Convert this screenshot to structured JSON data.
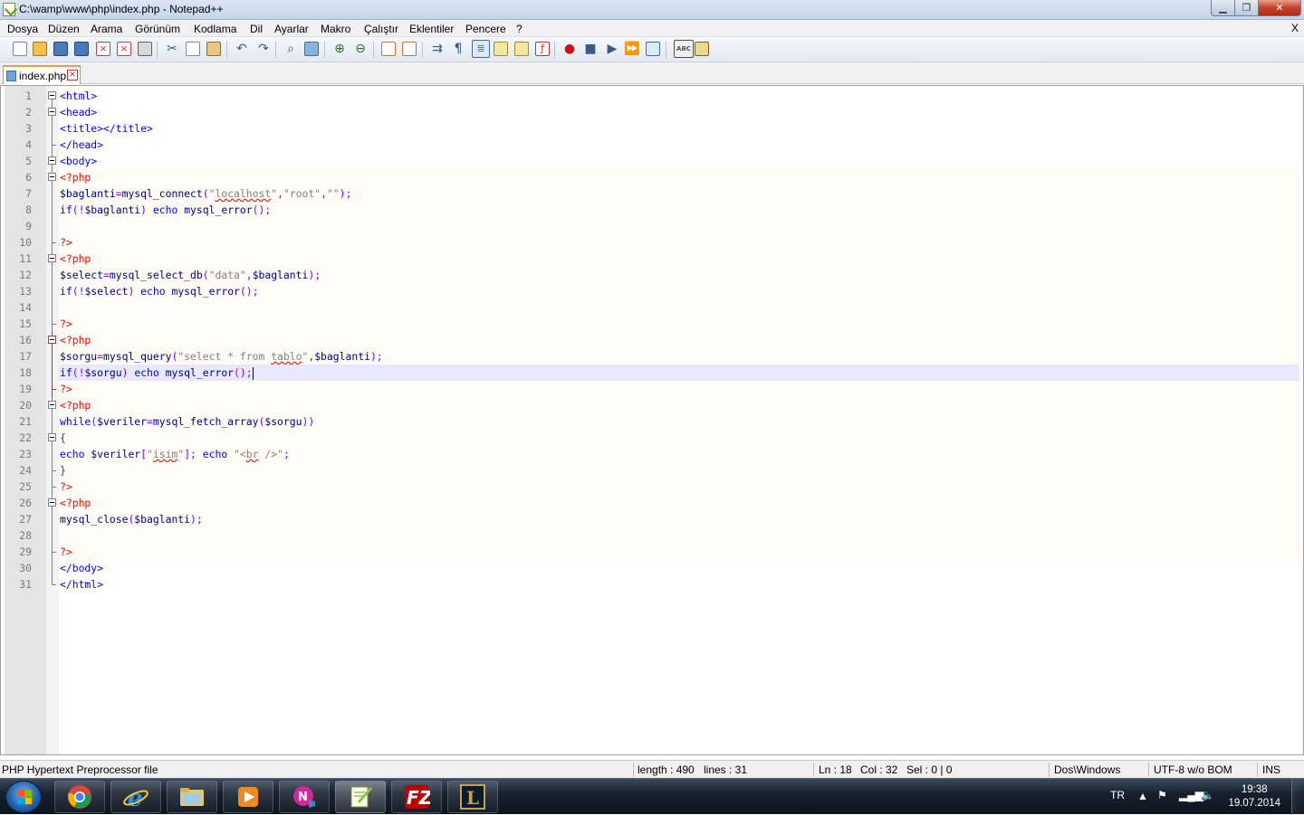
{
  "window": {
    "title": "C:\\wamp\\www\\php\\index.php - Notepad++",
    "min_label": "▁",
    "max_label": "❐",
    "close_label": "✕"
  },
  "menu": {
    "items": [
      "Dosya",
      "Düzen",
      "Arama",
      "Görünüm",
      "Kodlama",
      "Dil",
      "Ayarlar",
      "Makro",
      "Çalıştır",
      "Eklentiler",
      "Pencere",
      "?"
    ],
    "close": "X"
  },
  "toolbar": {
    "icons": [
      "new-file-icon",
      "open-file-icon",
      "save-icon",
      "save-all-icon",
      "close-icon",
      "close-all-icon",
      "print-icon",
      "cut-icon",
      "copy-icon",
      "paste-icon",
      "undo-icon",
      "redo-icon",
      "find-icon",
      "replace-icon",
      "zoom-in-icon",
      "zoom-out-icon",
      "sync-v-icon",
      "sync-h-icon",
      "word-wrap-icon",
      "show-all-chars-icon",
      "indent-guide-icon",
      "user-lang-icon",
      "doc-map-icon",
      "function-list-icon",
      "record-macro-icon",
      "stop-record-icon",
      "play-macro-icon",
      "run-macro-multiple-icon",
      "save-macro-icon",
      "spell-check-icon",
      "plugin-icon"
    ]
  },
  "tab": {
    "label": "index.php",
    "close": "✕"
  },
  "editor": {
    "current_line": 18,
    "lines": [
      {
        "n": "1",
        "fold": "box",
        "tokens": [
          [
            "<html>",
            "tag"
          ]
        ]
      },
      {
        "n": "2",
        "fold": "box",
        "tokens": [
          [
            "<head>",
            "tag"
          ]
        ]
      },
      {
        "n": "3",
        "fold": "line",
        "tokens": [
          [
            "<title></title>",
            "tag"
          ]
        ]
      },
      {
        "n": "4",
        "fold": "end",
        "tokens": [
          [
            "</head>",
            "tag"
          ]
        ]
      },
      {
        "n": "5",
        "fold": "box",
        "tokens": [
          [
            "<body>",
            "tag"
          ]
        ]
      },
      {
        "n": "6",
        "fold": "box",
        "php": true,
        "tokens": [
          [
            "<?php",
            "php"
          ]
        ]
      },
      {
        "n": "7",
        "fold": "line",
        "php": true,
        "tokens": [
          [
            "$baglanti",
            "var"
          ],
          [
            "=",
            "op"
          ],
          [
            "mysql_connect",
            "fn"
          ],
          [
            "(",
            "op"
          ],
          [
            "\"",
            "str"
          ],
          [
            "localhost",
            "strsq"
          ],
          [
            "\"",
            "str"
          ],
          [
            ",",
            "op"
          ],
          [
            "\"root\"",
            "str"
          ],
          [
            ",",
            "op"
          ],
          [
            "\"\"",
            "str"
          ],
          [
            ");",
            "op"
          ]
        ]
      },
      {
        "n": "8",
        "fold": "line",
        "php": true,
        "tokens": [
          [
            "if",
            "kw"
          ],
          [
            "(!",
            "op"
          ],
          [
            "$baglanti",
            "var"
          ],
          [
            ")",
            "op"
          ],
          [
            " ",
            "op"
          ],
          [
            "echo",
            "kw"
          ],
          [
            " ",
            "op"
          ],
          [
            "mysql_error",
            "fn"
          ],
          [
            "();",
            "op"
          ]
        ]
      },
      {
        "n": "9",
        "fold": "line",
        "php": true,
        "tokens": []
      },
      {
        "n": "10",
        "fold": "end",
        "php": true,
        "tokens": [
          [
            "?>",
            "php"
          ]
        ]
      },
      {
        "n": "11",
        "fold": "box",
        "php": true,
        "tokens": [
          [
            "<?php",
            "php"
          ]
        ]
      },
      {
        "n": "12",
        "fold": "line",
        "php": true,
        "tokens": [
          [
            "$select",
            "var"
          ],
          [
            "=",
            "op"
          ],
          [
            "mysql_select_db",
            "fn"
          ],
          [
            "(",
            "op"
          ],
          [
            "\"data\"",
            "str"
          ],
          [
            ",",
            "op"
          ],
          [
            "$baglanti",
            "var"
          ],
          [
            ");",
            "op"
          ]
        ]
      },
      {
        "n": "13",
        "fold": "line",
        "php": true,
        "tokens": [
          [
            "if",
            "kw"
          ],
          [
            "(!",
            "op"
          ],
          [
            "$select",
            "var"
          ],
          [
            ")",
            "op"
          ],
          [
            " ",
            "op"
          ],
          [
            "echo",
            "kw"
          ],
          [
            " ",
            "op"
          ],
          [
            "mysql_error",
            "fn"
          ],
          [
            "();",
            "op"
          ]
        ]
      },
      {
        "n": "14",
        "fold": "line",
        "php": true,
        "tokens": []
      },
      {
        "n": "15",
        "fold": "end",
        "php": true,
        "tokens": [
          [
            "?>",
            "php"
          ]
        ]
      },
      {
        "n": "16",
        "fold": "boxred",
        "php": true,
        "tokens": [
          [
            "<?php",
            "php"
          ]
        ]
      },
      {
        "n": "17",
        "fold": "linered",
        "php": true,
        "tokens": [
          [
            "$sorgu",
            "var"
          ],
          [
            "=",
            "op"
          ],
          [
            "mysql_query",
            "fn"
          ],
          [
            "(",
            "op"
          ],
          [
            "\"select * from ",
            "str"
          ],
          [
            "tablo",
            "strsq"
          ],
          [
            "\"",
            "str"
          ],
          [
            ",",
            "op"
          ],
          [
            "$baglanti",
            "var"
          ],
          [
            ");",
            "op"
          ]
        ]
      },
      {
        "n": "18",
        "fold": "linered",
        "php": true,
        "tokens": [
          [
            "if",
            "kw"
          ],
          [
            "(!",
            "op"
          ],
          [
            "$sorgu",
            "var"
          ],
          [
            ")",
            "op"
          ],
          [
            " ",
            "op"
          ],
          [
            "echo",
            "kw"
          ],
          [
            " ",
            "op"
          ],
          [
            "mysql_error",
            "fn"
          ],
          [
            "();",
            "op"
          ],
          [
            "",
            "caret"
          ]
        ]
      },
      {
        "n": "19",
        "fold": "endred",
        "php": true,
        "tokens": [
          [
            "?>",
            "php"
          ]
        ]
      },
      {
        "n": "20",
        "fold": "box",
        "php": true,
        "tokens": [
          [
            "<?php",
            "php"
          ]
        ]
      },
      {
        "n": "21",
        "fold": "line",
        "php": true,
        "tokens": [
          [
            "while",
            "kw"
          ],
          [
            "(",
            "op"
          ],
          [
            "$veriler",
            "var"
          ],
          [
            "=",
            "op"
          ],
          [
            "mysql_fetch_array",
            "fn"
          ],
          [
            "(",
            "op"
          ],
          [
            "$sorgu",
            "var"
          ],
          [
            "))",
            "op"
          ]
        ]
      },
      {
        "n": "22",
        "fold": "box",
        "php": true,
        "tokens": [
          [
            "{",
            "op"
          ]
        ]
      },
      {
        "n": "23",
        "fold": "line",
        "php": true,
        "tokens": [
          [
            "echo",
            "kw"
          ],
          [
            " ",
            "op"
          ],
          [
            "$veriler",
            "var"
          ],
          [
            "[",
            "op"
          ],
          [
            "\"",
            "str"
          ],
          [
            "isim",
            "strsq"
          ],
          [
            "\"",
            "str"
          ],
          [
            "];",
            "op"
          ],
          [
            " ",
            "op"
          ],
          [
            "echo",
            "kw"
          ],
          [
            " ",
            "op"
          ],
          [
            "\"<",
            "str"
          ],
          [
            "br",
            "strsq"
          ],
          [
            " />\"",
            "str"
          ],
          [
            ";",
            "op"
          ]
        ]
      },
      {
        "n": "24",
        "fold": "end",
        "php": true,
        "tokens": [
          [
            "}",
            "op"
          ]
        ]
      },
      {
        "n": "25",
        "fold": "end",
        "php": true,
        "tokens": [
          [
            "?>",
            "php"
          ]
        ]
      },
      {
        "n": "26",
        "fold": "box",
        "php": true,
        "tokens": [
          [
            "<?php",
            "php"
          ]
        ]
      },
      {
        "n": "27",
        "fold": "line",
        "php": true,
        "tokens": [
          [
            "mysql_close",
            "fn"
          ],
          [
            "(",
            "op"
          ],
          [
            "$baglanti",
            "var"
          ],
          [
            ");",
            "op"
          ]
        ]
      },
      {
        "n": "28",
        "fold": "line",
        "php": true,
        "tokens": []
      },
      {
        "n": "29",
        "fold": "end",
        "php": true,
        "tokens": [
          [
            "?>",
            "php"
          ]
        ]
      },
      {
        "n": "30",
        "fold": "line",
        "tokens": [
          [
            "</body>",
            "tag"
          ]
        ]
      },
      {
        "n": "31",
        "fold": "end",
        "tokens": [
          [
            "</html>",
            "tag"
          ]
        ]
      }
    ]
  },
  "status": {
    "filetype": "PHP Hypertext Preprocessor file",
    "length": "length : 490",
    "lines": "lines : 31",
    "ln": "Ln : 18",
    "col": "Col : 32",
    "sel": "Sel : 0 | 0",
    "eol": "Dos\\Windows",
    "encoding": "UTF-8 w/o BOM",
    "mode": "INS"
  },
  "taskbar": {
    "apps": [
      "Google Chrome",
      "Internet Explorer",
      "Windows Explorer",
      "Media Player",
      "Nero",
      "Notepad++",
      "FileZilla",
      "League of Legends"
    ],
    "lang": "TR",
    "time": "19:38",
    "date": "19.07.2014"
  }
}
